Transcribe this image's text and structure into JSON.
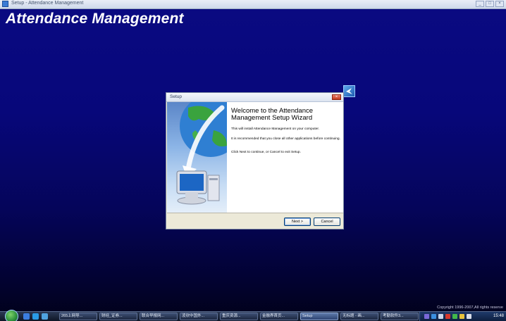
{
  "window": {
    "title": "Setup - Attendance Management",
    "controls": [
      "_",
      "□",
      "×"
    ]
  },
  "heading": "Attendance Management",
  "dialog": {
    "title": "Setup",
    "close_label": "×",
    "welcome_title": "Welcome to the Attendance Management Setup Wizard",
    "paragraphs": [
      "This will install Attendance Management on your computer.",
      "It is recommended that you close all other applications before continuing.",
      "Click Next to continue, or Cancel to exit Setup."
    ],
    "next_label": "Next >",
    "cancel_label": "Cancel"
  },
  "copyright": "Copyright 1996-2007,All rights reserve",
  "taskbar": {
    "tasks": [
      {
        "label": "265上网导..."
      },
      {
        "label": "财经_证券..."
      },
      {
        "label": "联合早报网..."
      },
      {
        "label": "凌欣中国外..."
      },
      {
        "label": "重庆资源..."
      },
      {
        "label": "金融界首页..."
      },
      {
        "label": "Setup",
        "active": true
      },
      {
        "label": "无标题 - 画..."
      },
      {
        "label": "考勤软件3..."
      }
    ],
    "clock": "15:48"
  },
  "colors": {
    "desktop_top": "#0a0a82",
    "desktop_bottom": "#010118",
    "dialog_face": "#ece9d8",
    "taskbar": "#0c1322",
    "tray": "#1f3a6a"
  }
}
